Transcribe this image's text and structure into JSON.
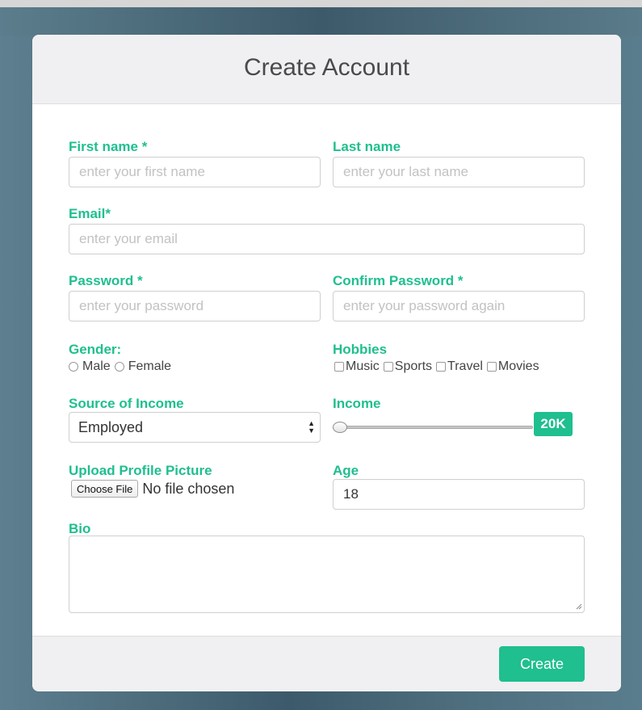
{
  "header": {
    "title": "Create Account"
  },
  "form": {
    "first_name": {
      "label": "First name *",
      "placeholder": "enter your first name"
    },
    "last_name": {
      "label": "Last name",
      "placeholder": "enter your last name"
    },
    "email": {
      "label": "Email*",
      "placeholder": "enter your email"
    },
    "password": {
      "label": "Password *",
      "placeholder": "enter your password"
    },
    "confirm_password": {
      "label": "Confirm Password *",
      "placeholder": "enter your password again"
    },
    "gender": {
      "label": "Gender:",
      "options": [
        "Male",
        "Female"
      ]
    },
    "hobbies": {
      "label": "Hobbies",
      "options": [
        "Music",
        "Sports",
        "Travel",
        "Movies"
      ]
    },
    "source_of_income": {
      "label": "Source of Income",
      "selected": "Employed"
    },
    "income": {
      "label": "Income",
      "value": "20K",
      "fraction": 0.0
    },
    "upload": {
      "label": "Upload Profile Picture",
      "button": "Choose File",
      "status": "No file chosen"
    },
    "age": {
      "label": "Age",
      "value": "18"
    },
    "bio": {
      "label": "Bio",
      "value": ""
    }
  },
  "footer": {
    "submit_label": "Create"
  },
  "colors": {
    "accent": "#1fbf8f",
    "label": "#1fbf8f",
    "panel": "#f0f0f2"
  }
}
